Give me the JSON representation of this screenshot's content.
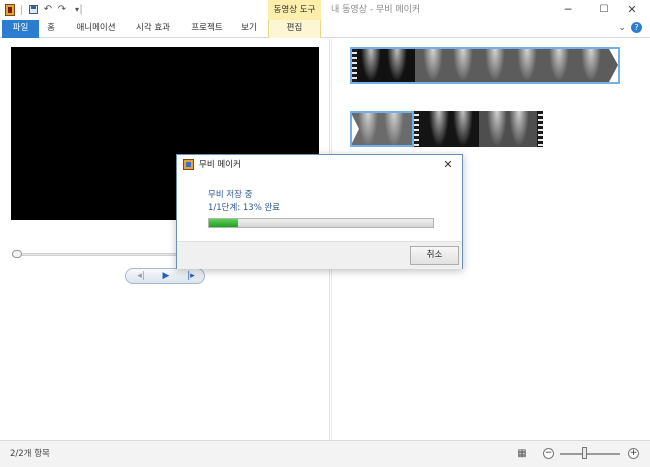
{
  "titlebar": {
    "title": "내 동영상 - 무비 메이커",
    "context_group": "동영상 도구",
    "qat_separator": "|",
    "controls": {
      "minimize": "─",
      "maximize": "☐",
      "close": "✕"
    }
  },
  "ribbon": {
    "tabs": [
      {
        "label": "파일"
      },
      {
        "label": "홈"
      },
      {
        "label": "애니메이션"
      },
      {
        "label": "시각 효과"
      },
      {
        "label": "프로젝트"
      },
      {
        "label": "보기"
      },
      {
        "label": "편집"
      }
    ],
    "help_glyphs": {
      "collapse": "⌄",
      "help": "?"
    }
  },
  "preview": {
    "transport": {
      "prev": "◂|",
      "play": "▶",
      "next": "|▸"
    }
  },
  "dialog": {
    "title": "무비 메이커",
    "status": "무비 저장 중",
    "step": "1/1단계: 13% 완료",
    "progress_fraction": 0.13,
    "cancel_label": "취소",
    "close_glyph": "✕"
  },
  "statusbar": {
    "text": "2/2개 항목",
    "zoom_out": "−",
    "zoom_in": "+",
    "zoom_fraction": 0.42
  },
  "colors": {
    "file_tab": "#2a7dd1",
    "context_tab": "#fbefab",
    "selection": "#6fb1e8",
    "progress": "#1da21d"
  },
  "icons": [
    "movie-maker-icon",
    "save-icon",
    "undo-icon",
    "redo-icon",
    "dropdown-icon",
    "storyboard-view-icon",
    "zoom-out-icon",
    "zoom-in-icon"
  ]
}
